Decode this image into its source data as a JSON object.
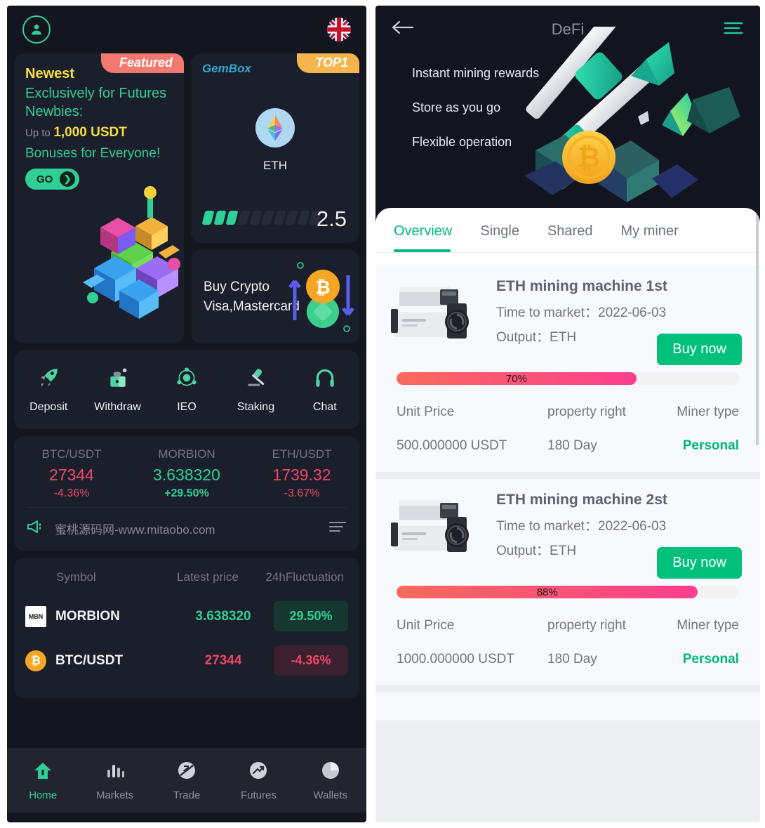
{
  "left": {
    "topbar": {
      "avatar_icon": "user-avatar-icon",
      "flag_icon": "uk-flag-icon"
    },
    "promo_banner": {
      "ribbon": "Featured",
      "newest": "Newest",
      "headline": "Exclusively for Futures Newbies:",
      "upto_label": "Up to",
      "amount": "1,000 USDT",
      "bonus_line": "Bonuses for Everyone!",
      "cta": "GO",
      "cta_icon": "chevron-right-icon",
      "art_icon": "isometric-city-illustration"
    },
    "gembox": {
      "label": "GemBox",
      "ribbon": "TOP1",
      "coin_icon": "eth-coin-icon",
      "coin_name": "ETH",
      "score": "2.5",
      "segments_total": 10,
      "segments_filled": 3
    },
    "buy_crypto": {
      "line1": "Buy Crypto",
      "line2": "Visa,Mastercard",
      "art_icon": "crypto-exchange-arrows-icon"
    },
    "quick_actions": [
      {
        "label": "Deposit",
        "icon": "rocket-icon"
      },
      {
        "label": "Withdraw",
        "icon": "safe-box-icon"
      },
      {
        "label": "IEO",
        "icon": "atom-icon"
      },
      {
        "label": "Staking",
        "icon": "gavel-icon"
      },
      {
        "label": "Chat",
        "icon": "headset-icon"
      }
    ],
    "tickers": [
      {
        "name": "BTC/USDT",
        "price": "27344",
        "change": "-4.36%",
        "dir": "down",
        "bold": false
      },
      {
        "name": "MORBION",
        "price": "3.638320",
        "change": "+29.50%",
        "dir": "up",
        "bold": true
      },
      {
        "name": "ETH/USDT",
        "price": "1739.32",
        "change": "-3.67%",
        "dir": "down",
        "bold": false
      }
    ],
    "notice": {
      "speaker_icon": "megaphone-icon",
      "text": "蜜桃源码网-www.mitaobo.com",
      "menu_icon": "list-menu-icon"
    },
    "market": {
      "headers": {
        "symbol": "Symbol",
        "price": "Latest price",
        "change": "24hFluctuation"
      },
      "rows": [
        {
          "icon": "morbion-logo-icon",
          "symbol": "MORBION",
          "price": "3.638320",
          "change": "29.50%",
          "dir": "up"
        },
        {
          "icon": "bitcoin-logo-icon",
          "symbol": "BTC/USDT",
          "price": "27344",
          "change": "-4.36%",
          "dir": "down"
        }
      ]
    },
    "bottom_nav": [
      {
        "label": "Home",
        "icon": "home-icon",
        "active": true
      },
      {
        "label": "Markets",
        "icon": "bar-chart-icon",
        "active": false
      },
      {
        "label": "Trade",
        "icon": "trade-swap-icon",
        "active": false
      },
      {
        "label": "Futures",
        "icon": "trend-arrow-icon",
        "active": false
      },
      {
        "label": "Wallets",
        "icon": "pie-chart-icon",
        "active": false
      }
    ]
  },
  "right": {
    "header": {
      "title": "DeFi",
      "back_icon": "arrow-left-icon",
      "menu_icon": "hamburger-menu-icon"
    },
    "hero": {
      "bullets": [
        "Instant mining rewards",
        "Store as you go",
        "Flexible operation"
      ],
      "art_icon": "pickaxe-crystal-bitcoin-illustration"
    },
    "tabs": [
      {
        "label": "Overview",
        "active": true
      },
      {
        "label": "Single",
        "active": false
      },
      {
        "label": "Shared",
        "active": false
      },
      {
        "label": "My miner",
        "active": false
      }
    ],
    "spec_headers": {
      "price": "Unit Price",
      "right": "property right",
      "type": "Miner type"
    },
    "miners": [
      {
        "image_icon": "asic-miner-photo",
        "name": "ETH mining machine 1st",
        "time_label": "Time to market：",
        "time_value": "2022-06-03",
        "output_label": "Output：",
        "output_value": "ETH",
        "buy_label": "Buy now",
        "progress_percent": 70,
        "progress_label": "70%",
        "unit_price": "500.000000 USDT",
        "property_right": "180 Day",
        "miner_type": "Personal"
      },
      {
        "image_icon": "asic-miner-photo",
        "name": "ETH mining machine 2st",
        "time_label": "Time to market：",
        "time_value": "2022-06-03",
        "output_label": "Output：",
        "output_value": "ETH",
        "buy_label": "Buy now",
        "progress_percent": 88,
        "progress_label": "88%",
        "unit_price": "1000.000000 USDT",
        "property_right": "180 Day",
        "miner_type": "Personal"
      }
    ]
  },
  "colors": {
    "accent_green": "#2fcf96",
    "right_green": "#00b87c",
    "down_red": "#ee4766",
    "yellow": "#f5e03a",
    "dark_bg": "#14161f",
    "card_bg": "#1b1e2b",
    "progress_start": "#f96a5c",
    "progress_end": "#fb3f8e"
  }
}
